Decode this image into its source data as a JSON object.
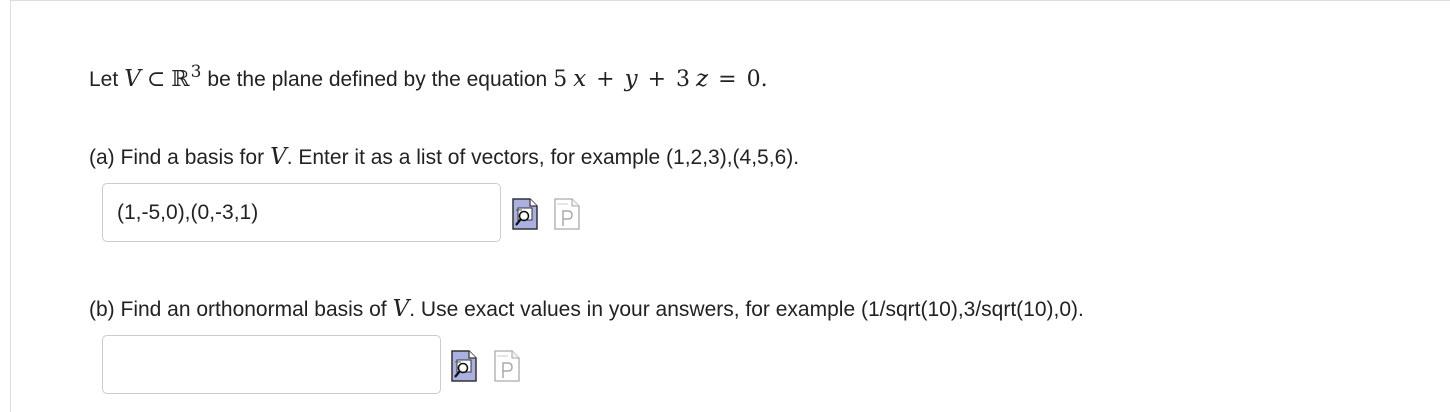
{
  "problem": {
    "intro_prefix": "Let",
    "intro_V": "V",
    "intro_subset": "⊂",
    "intro_R": "ℝ",
    "intro_exp": "3",
    "intro_mid": "be the plane defined by the equation",
    "eq_5": "5",
    "eq_x": "x",
    "eq_plus1": "+",
    "eq_y": "y",
    "eq_plus2": "+",
    "eq_3": "3",
    "eq_z": "z",
    "eq_equals": "=",
    "eq_0": "0",
    "intro_end": "."
  },
  "part_a": {
    "prefix": "(a) Find a basis for",
    "V": "V",
    "suffix": ". Enter it as a list of vectors, for example (1,2,3),(4,5,6).",
    "answer_value": "(1,-5,0),(0,-3,1)",
    "preview_icon": "preview-icon",
    "pg_icon": "pg-doc-icon"
  },
  "part_b": {
    "prefix": "(b) Find an orthonormal basis of",
    "V": "V",
    "suffix": ". Use exact values in your answers, for example (1/sqrt(10),3/sqrt(10),0).",
    "answer_value": "",
    "preview_icon": "preview-icon",
    "pg_icon": "pg-doc-icon"
  },
  "colors": {
    "icon_fill": "#aab0e0",
    "icon_outline": "#333333",
    "pg_icon_outline": "#aaaaaa",
    "input_border": "#cccccc"
  }
}
